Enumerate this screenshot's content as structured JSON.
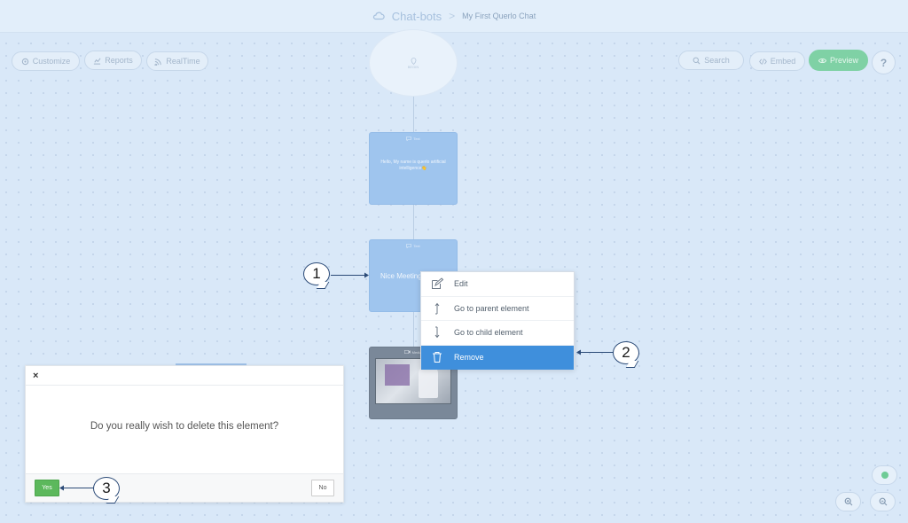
{
  "breadcrumb": {
    "root": "Chat-bots",
    "separator": ">",
    "current": "My First Querlo Chat"
  },
  "toolbar_left": {
    "customize": "Customize",
    "reports": "Reports",
    "realtime": "RealTime"
  },
  "toolbar_right": {
    "search": "Search",
    "embed": "Embed",
    "preview": "Preview",
    "help": "?"
  },
  "flow": {
    "start_label": "BEGIN",
    "node1": {
      "header": "Text",
      "text": "Hello, My name is querlo artificial intelligence👋"
    },
    "node2": {
      "header": "Text",
      "text": "Nice Meeting"
    },
    "node3": {
      "header": "Media"
    }
  },
  "context_menu": {
    "items": [
      {
        "label": "Edit",
        "icon": "edit-icon"
      },
      {
        "label": "Go to parent element",
        "icon": "arrow-up-icon"
      },
      {
        "label": "Go to child element",
        "icon": "arrow-down-icon"
      },
      {
        "label": "Remove",
        "icon": "trash-icon"
      }
    ]
  },
  "dialog": {
    "close": "×",
    "message": "Do you really wish to delete this element?",
    "yes": "Yes",
    "no": "No"
  },
  "callouts": {
    "c1": "1",
    "c2": "2",
    "c3": "3"
  },
  "colors": {
    "accent": "#3f8fdc",
    "success": "#5cb85c",
    "preview": "#7fd1a5",
    "node": "#9fc5ee"
  }
}
